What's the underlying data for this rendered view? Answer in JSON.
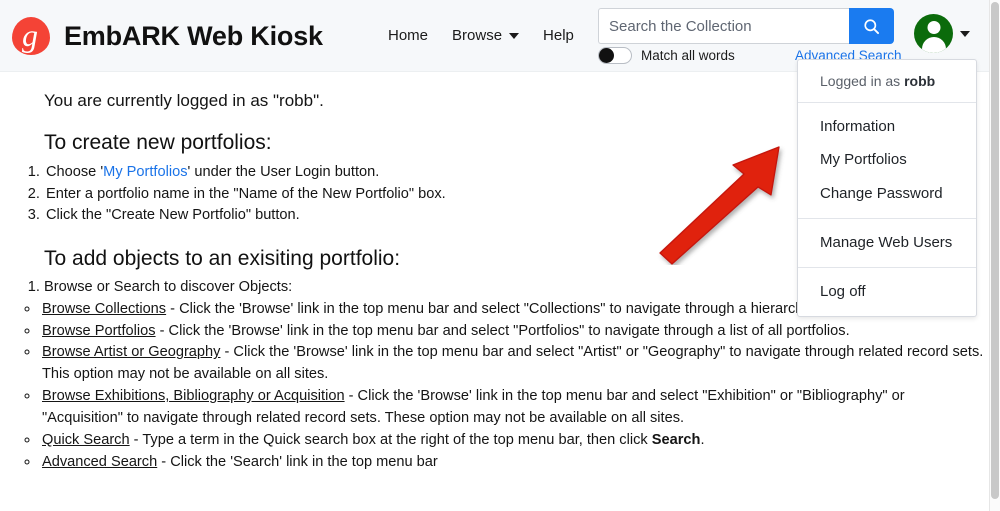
{
  "header": {
    "logo_icon": "embark-g-logo-icon",
    "site_title": "EmbARK Web Kiosk",
    "nav": [
      {
        "label": "Home",
        "has_caret": false
      },
      {
        "label": "Browse",
        "has_caret": true
      },
      {
        "label": "Help",
        "has_caret": false
      }
    ],
    "search": {
      "placeholder": "Search the Collection",
      "value": "",
      "button_icon": "search-icon",
      "match_all_words_label": "Match all words",
      "match_all_words_on": false,
      "advanced_search_label": "Advanced Search"
    },
    "avatar_icon": "user-avatar-icon",
    "avatar_caret_icon": "chevron-down-icon"
  },
  "user_menu": {
    "logged_in_prefix": "Logged in as ",
    "username": "robb",
    "group_account": [
      {
        "label": "Information"
      },
      {
        "label": "My Portfolios"
      },
      {
        "label": "Change Password"
      }
    ],
    "group_admin": [
      {
        "label": "Manage Web Users"
      }
    ],
    "group_session": [
      {
        "label": "Log off"
      }
    ]
  },
  "annotation": {
    "arrow_icon": "red-arrow-pointing-up-right-icon",
    "arrow_color": "#e02010"
  },
  "content": {
    "login_status": "You are currently logged in as \"robb\".",
    "create_heading": "To create new portfolios:",
    "create_steps": [
      {
        "pre": "Choose '",
        "link": "My Portfolios",
        "post": "' under the User Login button."
      },
      {
        "pre": "Enter a portfolio name in the \"Name of the New Portfolio\" box.",
        "link": "",
        "post": ""
      },
      {
        "pre": "Click the \"Create New Portfolio\" button.",
        "link": "",
        "post": ""
      }
    ],
    "add_heading": "To add objects to an exisiting portfolio:",
    "add_step_1": "Browse or Search to discover Objects:",
    "sub_items": [
      {
        "link": "Browse Collections",
        "text": " - Click the 'Browse' link in the top menu bar and select \"Collections\" to navigate through a hierarchical index of portfolios.",
        "bold_tail": "",
        "tail": ""
      },
      {
        "link": "Browse Portfolios",
        "text": " - Click the 'Browse' link in the top menu bar and select \"Portfolios\" to navigate through a list of all portfolios.",
        "bold_tail": "",
        "tail": ""
      },
      {
        "link": "Browse Artist or Geography",
        "text": " - Click the 'Browse' link in the top menu bar and select \"Artist\" or \"Geography\" to navigate through related record sets. This option may not be available on all sites.",
        "bold_tail": "",
        "tail": ""
      },
      {
        "link": "Browse Exhibitions, Bibliography or Acquisition",
        "text": " - Click the 'Browse' link in the top menu bar and select \"Exhibition\" or \"Bibliography\" or \"Acquisition\" to navigate through related record sets. These option may not be available on all sites.",
        "bold_tail": "",
        "tail": ""
      },
      {
        "link": "Quick Search",
        "text": " - Type a term in the Quick search box at the right of the top menu bar, then click ",
        "bold_tail": "Search",
        "tail": "."
      },
      {
        "link": "Advanced Search",
        "text": " - Click the 'Search' link in the top menu bar",
        "bold_tail": "",
        "tail": ""
      }
    ]
  },
  "scrollbar": {
    "orientation": "vertical"
  },
  "colors": {
    "header_bg": "#f6f8fa",
    "accent_blue": "#1a7bf0",
    "link_blue": "#1a73e8",
    "avatar_green": "#0b6b0b",
    "logo_red": "#f44336",
    "arrow_red": "#e02010"
  }
}
